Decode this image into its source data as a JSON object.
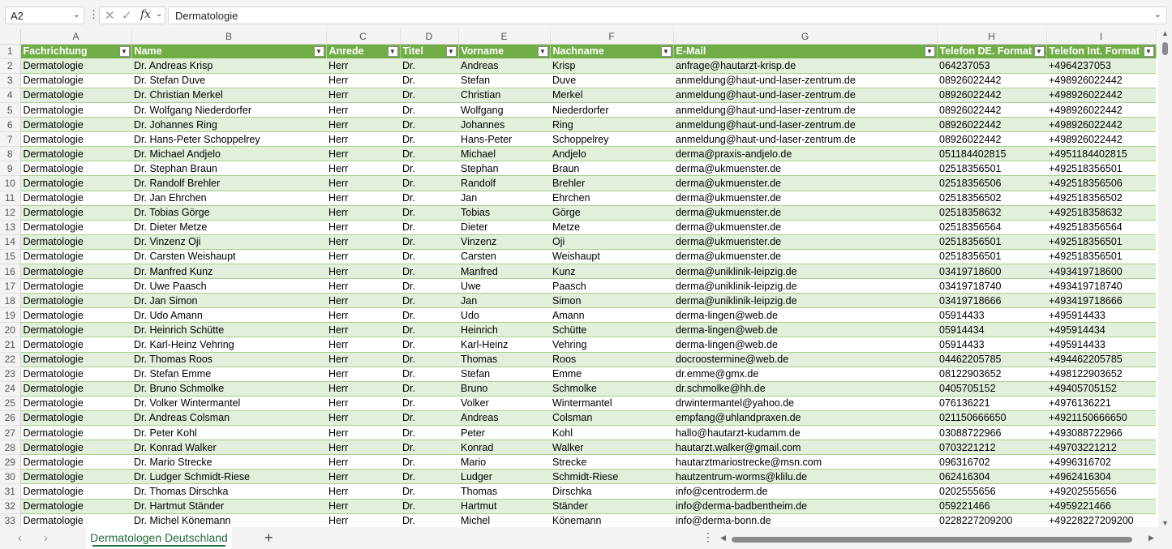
{
  "formula_bar": {
    "name_box": "A2",
    "fx_label": "fx",
    "cancel_glyph": "✕",
    "enter_glyph": "✓",
    "content": "Dermatologie"
  },
  "columns": [
    "A",
    "B",
    "C",
    "D",
    "E",
    "F",
    "G",
    "H",
    "I"
  ],
  "header_row": [
    "Fachrichtung",
    "Name",
    "Anrede",
    "Titel",
    "Vorname",
    "Nachname",
    "E-Mail",
    "Telefon DE. Format",
    "Telefon Int. Format"
  ],
  "rows": [
    [
      "Dermatologie",
      "Dr. Andreas Krisp",
      "Herr",
      "Dr.",
      "Andreas",
      "Krisp",
      "anfrage@hautarzt-krisp.de",
      "064237053",
      "+4964237053"
    ],
    [
      "Dermatologie",
      "Dr. Stefan Duve",
      "Herr",
      "Dr.",
      "Stefan",
      "Duve",
      "anmeldung@haut-und-laser-zentrum.de",
      "08926022442",
      "+498926022442"
    ],
    [
      "Dermatologie",
      "Dr. Christian Merkel",
      "Herr",
      "Dr.",
      "Christian",
      "Merkel",
      "anmeldung@haut-und-laser-zentrum.de",
      "08926022442",
      "+498926022442"
    ],
    [
      "Dermatologie",
      "Dr. Wolfgang Niederdorfer",
      "Herr",
      "Dr.",
      "Wolfgang",
      "Niederdorfer",
      "anmeldung@haut-und-laser-zentrum.de",
      "08926022442",
      "+498926022442"
    ],
    [
      "Dermatologie",
      "Dr. Johannes Ring",
      "Herr",
      "Dr.",
      "Johannes",
      "Ring",
      "anmeldung@haut-und-laser-zentrum.de",
      "08926022442",
      "+498926022442"
    ],
    [
      "Dermatologie",
      "Dr. Hans-Peter Schoppelrey",
      "Herr",
      "Dr.",
      "Hans-Peter",
      "Schoppelrey",
      "anmeldung@haut-und-laser-zentrum.de",
      "08926022442",
      "+498926022442"
    ],
    [
      "Dermatologie",
      "Dr. Michael Andjelo",
      "Herr",
      "Dr.",
      "Michael",
      "Andjelo",
      "derma@praxis-andjelo.de",
      "051184402815",
      "+4951184402815"
    ],
    [
      "Dermatologie",
      "Dr. Stephan Braun",
      "Herr",
      "Dr.",
      "Stephan",
      "Braun",
      "derma@ukmuenster.de",
      "02518356501",
      "+492518356501"
    ],
    [
      "Dermatologie",
      "Dr. Randolf Brehler",
      "Herr",
      "Dr.",
      "Randolf",
      "Brehler",
      "derma@ukmuenster.de",
      "02518356506",
      "+492518356506"
    ],
    [
      "Dermatologie",
      "Dr. Jan Ehrchen",
      "Herr",
      "Dr.",
      "Jan",
      "Ehrchen",
      "derma@ukmuenster.de",
      "02518356502",
      "+492518356502"
    ],
    [
      "Dermatologie",
      "Dr. Tobias Görge",
      "Herr",
      "Dr.",
      "Tobias",
      "Görge",
      "derma@ukmuenster.de",
      "02518358632",
      "+492518358632"
    ],
    [
      "Dermatologie",
      "Dr. Dieter Metze",
      "Herr",
      "Dr.",
      "Dieter",
      "Metze",
      "derma@ukmuenster.de",
      "02518356564",
      "+492518356564"
    ],
    [
      "Dermatologie",
      "Dr. Vinzenz Oji",
      "Herr",
      "Dr.",
      "Vinzenz",
      "Oji",
      "derma@ukmuenster.de",
      "02518356501",
      "+492518356501"
    ],
    [
      "Dermatologie",
      "Dr. Carsten Weishaupt",
      "Herr",
      "Dr.",
      "Carsten",
      "Weishaupt",
      "derma@ukmuenster.de",
      "02518356501",
      "+492518356501"
    ],
    [
      "Dermatologie",
      "Dr. Manfred Kunz",
      "Herr",
      "Dr.",
      "Manfred",
      "Kunz",
      "derma@uniklinik-leipzig.de",
      "03419718600",
      "+493419718600"
    ],
    [
      "Dermatologie",
      "Dr. Uwe Paasch",
      "Herr",
      "Dr.",
      "Uwe",
      "Paasch",
      "derma@uniklinik-leipzig.de",
      "03419718740",
      "+493419718740"
    ],
    [
      "Dermatologie",
      "Dr. Jan Simon",
      "Herr",
      "Dr.",
      "Jan",
      "Simon",
      "derma@uniklinik-leipzig.de",
      "03419718666",
      "+493419718666"
    ],
    [
      "Dermatologie",
      "Dr. Udo Amann",
      "Herr",
      "Dr.",
      "Udo",
      "Amann",
      "derma-lingen@web.de",
      "05914433",
      "+495914433"
    ],
    [
      "Dermatologie",
      "Dr. Heinrich Schütte",
      "Herr",
      "Dr.",
      "Heinrich",
      "Schütte",
      "derma-lingen@web.de",
      "05914434",
      "+495914434"
    ],
    [
      "Dermatologie",
      "Dr. Karl-Heinz Vehring",
      "Herr",
      "Dr.",
      "Karl-Heinz",
      "Vehring",
      "derma-lingen@web.de",
      "05914433",
      "+495914433"
    ],
    [
      "Dermatologie",
      "Dr. Thomas Roos",
      "Herr",
      "Dr.",
      "Thomas",
      "Roos",
      "docroostermine@web.de",
      "04462205785",
      "+494462205785"
    ],
    [
      "Dermatologie",
      "Dr. Stefan Emme",
      "Herr",
      "Dr.",
      "Stefan",
      "Emme",
      "dr.emme@gmx.de",
      "08122903652",
      "+498122903652"
    ],
    [
      "Dermatologie",
      "Dr. Bruno Schmolke",
      "Herr",
      "Dr.",
      "Bruno",
      "Schmolke",
      "dr.schmolke@hh.de",
      "0405705152",
      "+49405705152"
    ],
    [
      "Dermatologie",
      "Dr. Volker Wintermantel",
      "Herr",
      "Dr.",
      "Volker",
      "Wintermantel",
      "drwintermantel@yahoo.de",
      "076136221",
      "+4976136221"
    ],
    [
      "Dermatologie",
      "Dr. Andreas Colsman",
      "Herr",
      "Dr.",
      "Andreas",
      "Colsman",
      "empfang@uhlandpraxen.de",
      "021150666650",
      "+4921150666650"
    ],
    [
      "Dermatologie",
      "Dr. Peter Kohl",
      "Herr",
      "Dr.",
      "Peter",
      "Kohl",
      "hallo@hautarzt-kudamm.de",
      "03088722966",
      "+493088722966"
    ],
    [
      "Dermatologie",
      "Dr. Konrad Walker",
      "Herr",
      "Dr.",
      "Konrad",
      "Walker",
      "hautarzt.walker@gmail.com",
      "0703221212",
      "+49703221212"
    ],
    [
      "Dermatologie",
      "Dr. Mario Strecke",
      "Herr",
      "Dr.",
      "Mario",
      "Strecke",
      "hautarztmariostrecke@msn.com",
      "096316702",
      "+4996316702"
    ],
    [
      "Dermatologie",
      "Dr. Ludger Schmidt-Riese",
      "Herr",
      "Dr.",
      "Ludger",
      "Schmidt-Riese",
      "hautzentrum-worms@klilu.de",
      "062416304",
      "+4962416304"
    ],
    [
      "Dermatologie",
      "Dr. Thomas Dirschka",
      "Herr",
      "Dr.",
      "Thomas",
      "Dirschka",
      "info@centroderm.de",
      "0202555656",
      "+49202555656"
    ],
    [
      "Dermatologie",
      "Dr. Hartmut Ständer",
      "Herr",
      "Dr.",
      "Hartmut",
      "Ständer",
      "info@derma-badbentheim.de",
      "059221466",
      "+4959221466"
    ],
    [
      "Dermatologie",
      "Dr. Michel Könemann",
      "Herr",
      "Dr.",
      "Michel",
      "Könemann",
      "info@derma-bonn.de",
      "0228227209200",
      "+49228227209200"
    ]
  ],
  "sheet_tab": {
    "label": "Dermatologen Deutschland"
  },
  "colors": {
    "header_bg": "#70ad47",
    "band_bg": "#e2efda",
    "border": "#a9d08e",
    "tab_accent": "#1f6a3a"
  },
  "icons": [
    "name-box-dropdown-icon",
    "cancel-icon",
    "enter-icon",
    "function-icon",
    "filter-dropdown-icon",
    "add-sheet-icon",
    "scroll-left-icon",
    "scroll-right-icon"
  ]
}
